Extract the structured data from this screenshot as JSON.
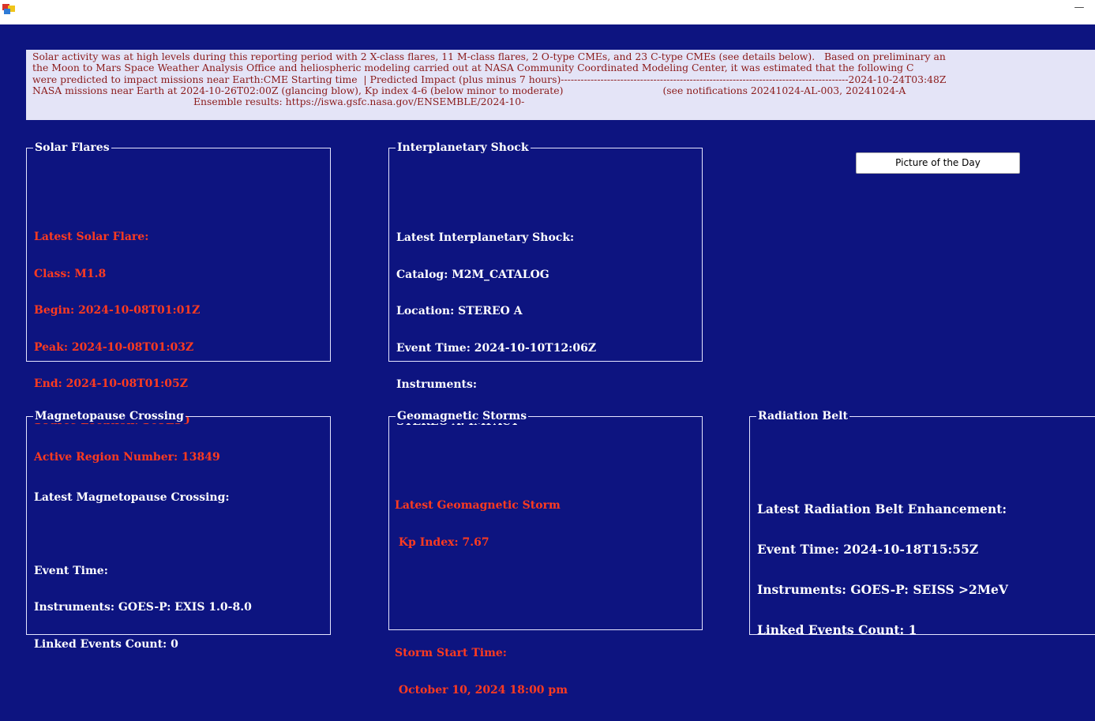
{
  "window": {
    "app_icon": "winforms-app-icon",
    "minimize_glyph": "—"
  },
  "summary": {
    "lines": [
      "Solar activity was at high levels during this reporting period with 2 X-class flares, 11 M-class flares, 2 O-type CMEs, and 23 C-type CMEs (see details below).   Based on preliminary an",
      "the Moon to Mars Space Weather Analysis Office and heliospheric modeling carried out at NASA Community Coordinated Modeling Center, it was estimated that the following C",
      "were predicted to impact missions near Earth:CME Starting time  | Predicted Impact (plus minus 7 hours)---------------------------------------------------------------------------------------2024-10-24T03:48Z",
      "NASA missions near Earth at 2024-10-26T02:00Z (glancing blow), Kp index 4-6 (below minor to moderate)                                (see notifications 20241024-AL-003, 20241024-A",
      "Ensemble results: https://iswa.gsfc.nasa.gov/ENSEMBLE/2024-10-"
    ]
  },
  "solar_flares": {
    "title": "Solar Flares",
    "heading": "Latest Solar Flare:",
    "class": "Class: M1.8",
    "begin": "Begin: 2024-10-08T01:01Z",
    "peak": "Peak: 2024-10-08T01:03Z",
    "end": "End: 2024-10-08T01:05Z",
    "source": "Source Location: S09E30",
    "region": "Active Region Number: 13849"
  },
  "shock": {
    "title": "Interplanetary Shock",
    "heading": "Latest Interplanetary Shock:",
    "catalog": "Catalog: M2M_CATALOG",
    "location": "Location: STEREO A",
    "event_time": "Event Time: 2024-10-10T12:06Z",
    "instruments": "Instruments:",
    "instrument_value": "STEREO A: IMPACT"
  },
  "picture_button": {
    "label": "Picture of the Day"
  },
  "magnetopause": {
    "title": "Magnetopause Crossing",
    "heading": "Latest Magnetopause Crossing:",
    "event_time": "Event Time:",
    "instruments": "Instruments: GOES-P: EXIS 1.0-8.0",
    "linked": "Linked Events Count: 0"
  },
  "geomagnetic": {
    "title": "Geomagnetic Storms",
    "heading": "Latest Geomagnetic Storm",
    "kp": " Kp Index: 7.67",
    "start_label": "Storm Start Time:",
    "start_value": " October 10, 2024 18:00 pm"
  },
  "radiation": {
    "title": "Radiation Belt",
    "heading": "Latest Radiation Belt Enhancement:",
    "event_time": "Event Time: 2024-10-18T15:55Z",
    "instruments": "Instruments: GOES-P: SEISS >2MeV",
    "linked": "Linked Events Count: 1"
  }
}
